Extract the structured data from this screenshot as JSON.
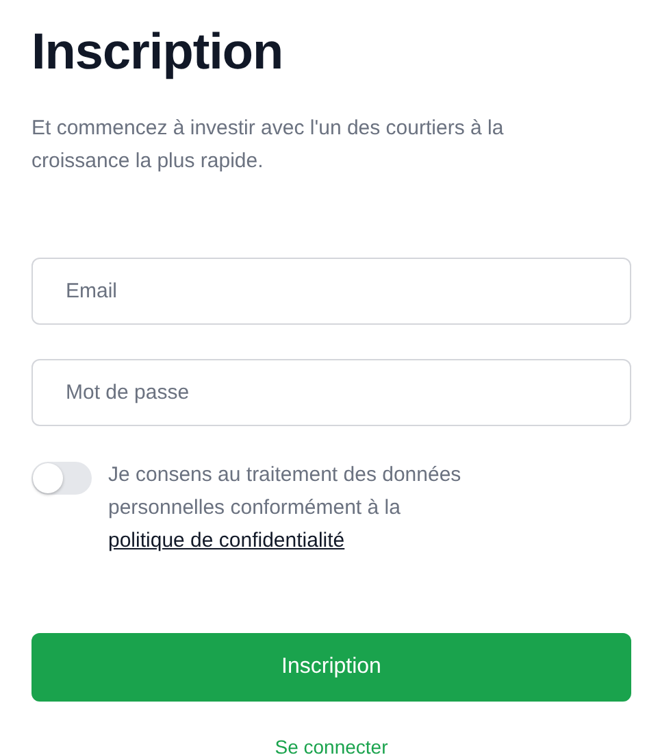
{
  "title": "Inscription",
  "subtitle": "Et commencez à investir avec l'un des courtiers à la croissance la plus rapide.",
  "fields": [
    {
      "placeholder": "Email"
    },
    {
      "placeholder": "Mot de passe"
    }
  ],
  "consent": {
    "on": false,
    "text": "Je consens au traitement des données personnelles conformément à la",
    "link": "politique de confidentialité"
  },
  "submit": "Inscription",
  "login_link": "Se connecter"
}
